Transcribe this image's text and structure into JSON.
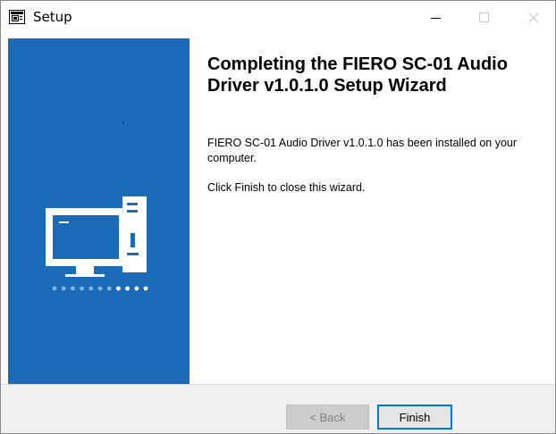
{
  "window": {
    "title": "Setup",
    "icon": "setup-app-icon",
    "controls": [
      "minimize-icon",
      "maximize-icon",
      "close-icon"
    ]
  },
  "banner": {
    "color": "#1c6bb8",
    "illustration": "computer-icon",
    "progress_dots_filled": 4,
    "progress_dots_total": 11
  },
  "content": {
    "heading": "Completing the FIERO SC-01 Audio Driver v1.0.1.0 Setup Wizard",
    "installed_message": "FIERO SC-01 Audio Driver v1.0.1.0 has been installed on your computer.",
    "instruction": "Click Finish to close this wizard."
  },
  "buttons": {
    "back_label": "< Back",
    "finish_label": "Finish"
  }
}
